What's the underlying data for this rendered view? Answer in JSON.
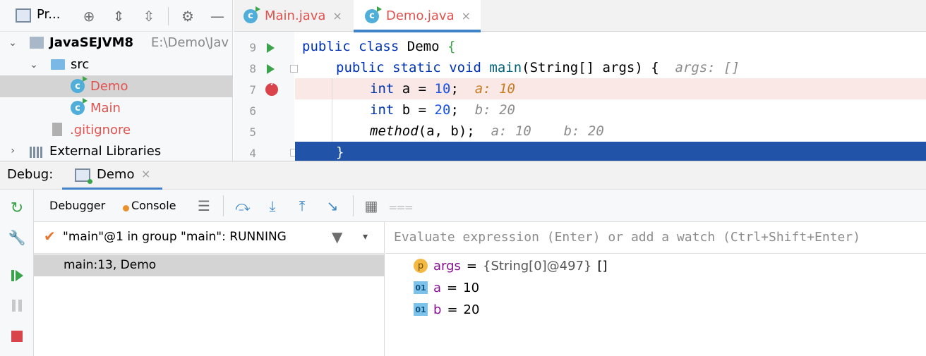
{
  "project": {
    "title": "Pr...",
    "tree": [
      {
        "label": "JavaSEJVM8",
        "path": "E:\\Demo\\Jav"
      },
      {
        "label": "src"
      },
      {
        "label": "Demo"
      },
      {
        "label": "Main"
      },
      {
        "label": ".gitignore"
      },
      {
        "label": "External Libraries"
      }
    ]
  },
  "editor": {
    "tabs": [
      {
        "label": "Main.java"
      },
      {
        "label": "Demo.java"
      }
    ],
    "close_glyph": "×",
    "line_numbers": [
      "9",
      "8",
      "7",
      "6",
      "5",
      "4"
    ],
    "lines": {
      "l9": {
        "kw1": "public",
        "kw2": "class",
        "name": "Demo",
        "brace": "{"
      },
      "l8": {
        "kw1": "public",
        "kw2": "static",
        "kw3": "void",
        "name": "main",
        "params": "(String[] args) {",
        "hint": "args: []"
      },
      "l7": {
        "kw": "int",
        "rest": "a = ",
        "num": "10",
        "semi": ";",
        "hint": "a: 10"
      },
      "l6": {
        "kw": "int",
        "rest": "b = ",
        "num": "20",
        "semi": ";",
        "hint": "b: 20"
      },
      "l5": {
        "call": "method",
        "args": "(a, b);",
        "hint1": "a: 10",
        "hint2": "b: 20"
      },
      "l4": {
        "brace": "}"
      }
    }
  },
  "debug": {
    "title": "Debug:",
    "session_tab": "Demo",
    "tabs": {
      "debugger": "Debugger",
      "console": "Console"
    },
    "thread": "\"main\"@1 in group \"main\": RUNNING",
    "frame": "main:13, Demo",
    "eval_placeholder": "Evaluate expression (Enter) or add a watch (Ctrl+Shift+Enter)",
    "variables": [
      {
        "badge": "p",
        "name": "args",
        "eq": "=",
        "value": "{String[0]@497}",
        "extra": "[]"
      },
      {
        "badge": "01",
        "name": "a",
        "eq": "=",
        "value": "10"
      },
      {
        "badge": "01",
        "name": "b",
        "eq": "=",
        "value": "20"
      }
    ]
  },
  "colors": {
    "accent": "#4083c9",
    "run": "#3ba34a",
    "breakpoint": "#d9434a",
    "exec_line": "#2154a8",
    "file_red": "#e0524e"
  }
}
